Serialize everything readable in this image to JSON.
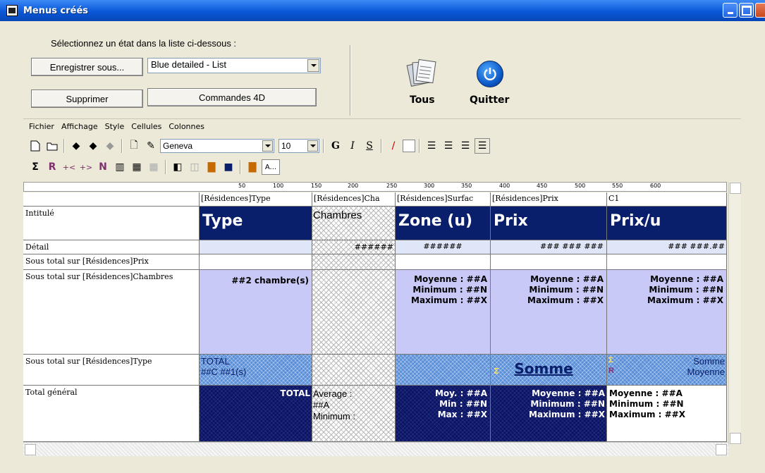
{
  "window": {
    "title": "Menus créés"
  },
  "controls": {
    "select_label": "Sélectionnez un état dans la liste ci-dessous :",
    "save_as_label": "Enregistrer sous...",
    "report_selected": "Blue detailed - List",
    "delete_label": "Supprimer",
    "commands_label": "Commandes 4D",
    "tous_label": "Tous",
    "quit_label": "Quitter"
  },
  "editor": {
    "menu": [
      "Fichier",
      "Affichage",
      "Style",
      "Cellules",
      "Colonnes"
    ],
    "font_name": "Geneva",
    "font_size": "10",
    "style_bold": "G",
    "style_italic": "I",
    "style_underline": "S",
    "color_btn_label": "A...",
    "ruler_ticks": [
      "50",
      "100",
      "150",
      "200",
      "250",
      "300",
      "350",
      "400",
      "450",
      "500",
      "550",
      "600"
    ]
  },
  "grid": {
    "columns": [
      "[Résidences]Type",
      "[Résidences]Cha",
      "[Résidences]Surfac",
      "[Résidences]Prix",
      "C1"
    ],
    "rows": [
      "Intitulé",
      "Détail",
      "Sous total sur [Résidences]Prix",
      "Sous total sur [Résidences]Chambres",
      "Sous total sur [Résidences]Type",
      "Total général"
    ],
    "intitule": [
      "Type",
      "Chambres",
      "Zone (u)",
      "Prix",
      "Prix/u"
    ],
    "detail": [
      "######",
      "######",
      "### ### ###",
      "### ###.##"
    ],
    "chambres_sub": "##2 chambre(s)",
    "stats_full": [
      "Moyenne : ##A",
      "Minimum : ##N",
      "Maximum : ##X"
    ],
    "type_total": [
      "TOTAL",
      "##C ##1(s)"
    ],
    "somme": "Somme",
    "c1_type": [
      "Somme",
      "Moyenne"
    ],
    "total_label": "TOTAL",
    "average_col": [
      "Average :",
      "##A",
      "Minimum :"
    ],
    "stats_short": [
      "Moy. : ##A",
      "Min : ##N",
      "Max : ##X"
    ]
  }
}
